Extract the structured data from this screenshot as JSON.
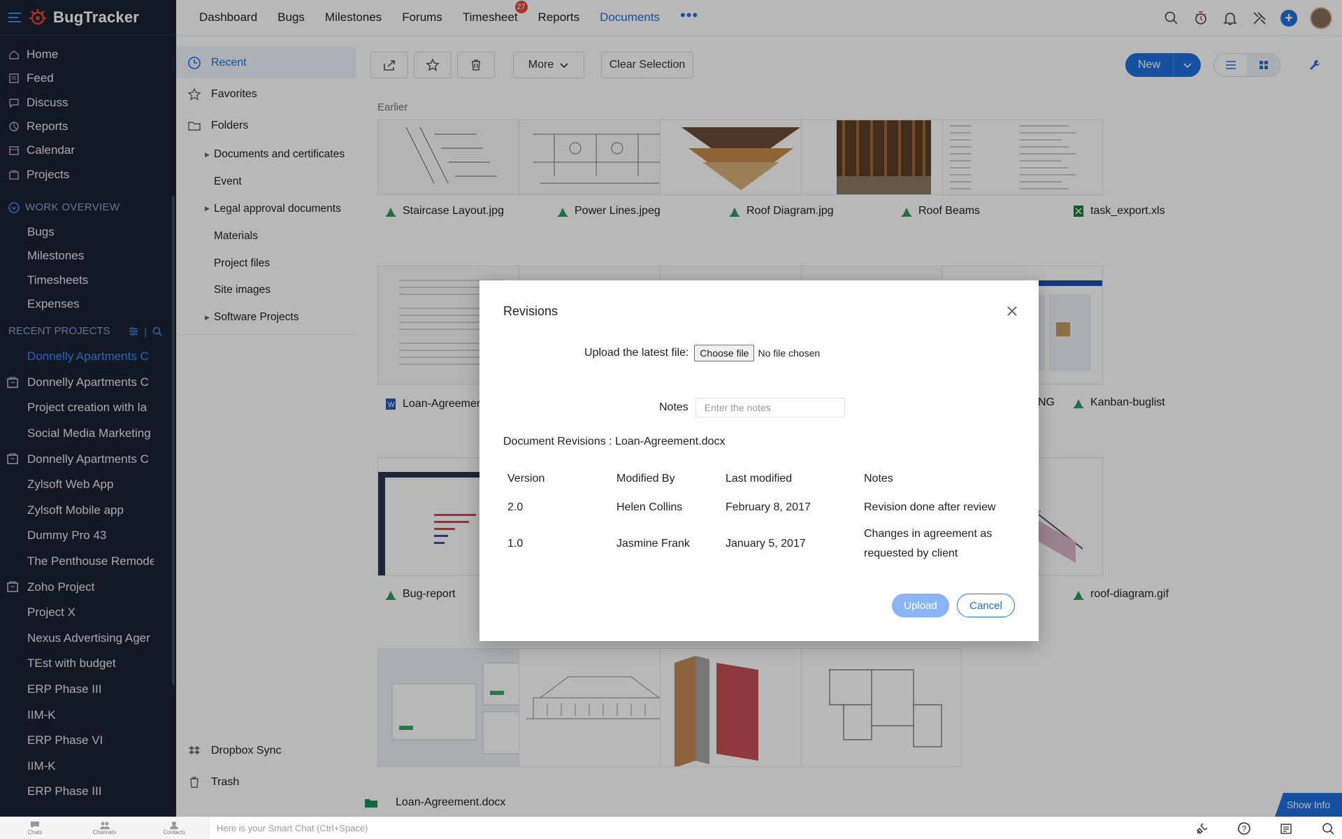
{
  "app": {
    "name": "BugTracker"
  },
  "sidebar": {
    "nav": [
      {
        "label": "Home",
        "icon": "home-icon"
      },
      {
        "label": "Feed",
        "icon": "feed-icon"
      },
      {
        "label": "Discuss",
        "icon": "discuss-icon"
      },
      {
        "label": "Reports",
        "icon": "reports-icon"
      },
      {
        "label": "Calendar",
        "icon": "calendar-icon"
      },
      {
        "label": "Projects",
        "icon": "projects-icon"
      }
    ],
    "work_overview": {
      "title": "WORK OVERVIEW",
      "items": [
        "Bugs",
        "Milestones",
        "Timesheets",
        "Expenses"
      ]
    },
    "recent_projects": {
      "title": "RECENT PROJECTS",
      "items": [
        {
          "label": "Donnelly Apartments C",
          "active": true,
          "icon": false
        },
        {
          "label": "Donnelly Apartments C",
          "active": false,
          "icon": true
        },
        {
          "label": "Project creation with la",
          "active": false,
          "icon": false
        },
        {
          "label": "Social Media Marketing",
          "active": false,
          "icon": false
        },
        {
          "label": "Donnelly Apartments C",
          "active": false,
          "icon": true
        },
        {
          "label": "Zylsoft Web App",
          "active": false,
          "icon": false
        },
        {
          "label": "Zylsoft Mobile app",
          "active": false,
          "icon": false
        },
        {
          "label": "Dummy Pro 43",
          "active": false,
          "icon": false
        },
        {
          "label": "The Penthouse Remode",
          "active": false,
          "icon": false
        },
        {
          "label": "Zoho Project",
          "active": false,
          "icon": true
        },
        {
          "label": "Project X",
          "active": false,
          "icon": false
        },
        {
          "label": "Nexus Advertising Ager",
          "active": false,
          "icon": false
        },
        {
          "label": "TEst with budget",
          "active": false,
          "icon": false
        },
        {
          "label": "ERP Phase III",
          "active": false,
          "icon": false
        },
        {
          "label": "IIM-K",
          "active": false,
          "icon": false
        },
        {
          "label": "ERP Phase VI",
          "active": false,
          "icon": false
        },
        {
          "label": "IIM-K",
          "active": false,
          "icon": false
        },
        {
          "label": "ERP Phase III",
          "active": false,
          "icon": false
        }
      ]
    }
  },
  "topnav": {
    "tabs": [
      {
        "label": "Dashboard"
      },
      {
        "label": "Bugs"
      },
      {
        "label": "Milestones"
      },
      {
        "label": "Forums"
      },
      {
        "label": "Timesheet",
        "badge": "27"
      },
      {
        "label": "Reports"
      },
      {
        "label": "Documents",
        "active": true
      }
    ],
    "more": "•••"
  },
  "folders": {
    "recent": "Recent",
    "favorites": "Favorites",
    "folders": "Folders",
    "subfolders": [
      {
        "label": "Documents and certificates",
        "arrow": true
      },
      {
        "label": "Event",
        "arrow": false
      },
      {
        "label": "Legal approval documents",
        "arrow": true
      },
      {
        "label": "Materials",
        "arrow": false
      },
      {
        "label": "Project files",
        "arrow": false
      },
      {
        "label": "Site images",
        "arrow": false
      },
      {
        "label": "Software Projects",
        "arrow": true
      }
    ],
    "dropbox": "Dropbox Sync",
    "trash": "Trash"
  },
  "toolbar": {
    "more": "More",
    "clear_selection": "Clear Selection",
    "new": "New"
  },
  "grid": {
    "section": "Earlier",
    "row1": [
      "Staircase Layout.jpg",
      "Power Lines.jpeg",
      "Roof Diagram.jpg",
      "Roof Beams",
      "task_export.xls"
    ],
    "row2": [
      "Loan-Agreemen",
      "NG",
      "Kanban-buglist"
    ],
    "row3": [
      "Bug-report",
      "roof-diagram.gif"
    ],
    "bottom_file": "Loan-Agreement.docx",
    "show_info": "Show Info"
  },
  "chatbar": {
    "chats": "Chats",
    "channels": "Channels",
    "contacts": "Contacts",
    "placeholder": "Here is your Smart Chat (Ctrl+Space)"
  },
  "modal": {
    "title": "Revisions",
    "upload_label": "Upload the latest file:",
    "choose_file": "Choose file",
    "no_file": "No file chosen",
    "notes_label": "Notes",
    "notes_placeholder": "Enter the notes",
    "doc_revisions": "Document Revisions : Loan-Agreement.docx",
    "columns": [
      "Version",
      "Modified By",
      "Last modified",
      "Notes"
    ],
    "rows": [
      {
        "version": "2.0",
        "modified_by": "Helen Collins",
        "last_modified": "February 8, 2017",
        "notes": "Revision done after review"
      },
      {
        "version": "1.0",
        "modified_by": "Jasmine Frank",
        "last_modified": "January 5, 2017",
        "notes": "Changes in agreement as requested by client"
      }
    ],
    "upload_btn": "Upload",
    "cancel_btn": "Cancel"
  },
  "colors": {
    "accent": "#1f6fe0",
    "sidebar_bg": "#1b2333",
    "badge": "#e9443a"
  }
}
